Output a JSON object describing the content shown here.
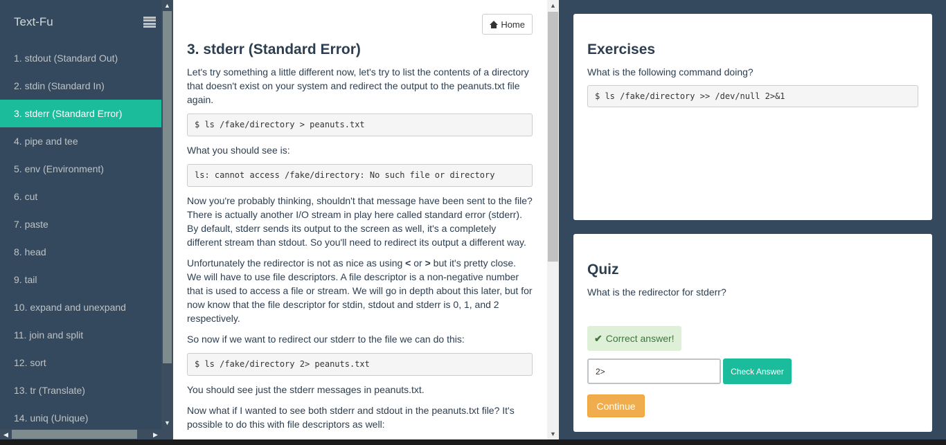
{
  "sidebar": {
    "brand": "Text-Fu",
    "items": [
      {
        "label": "1. stdout (Standard Out)"
      },
      {
        "label": "2. stdin (Standard In)"
      },
      {
        "label": "3. stderr (Standard Error)"
      },
      {
        "label": "4. pipe and tee"
      },
      {
        "label": "5. env (Environment)"
      },
      {
        "label": "6. cut"
      },
      {
        "label": "7. paste"
      },
      {
        "label": "8. head"
      },
      {
        "label": "9. tail"
      },
      {
        "label": "10. expand and unexpand"
      },
      {
        "label": "11. join and split"
      },
      {
        "label": "12. sort"
      },
      {
        "label": "13. tr (Translate)"
      },
      {
        "label": "14. uniq (Unique)"
      }
    ],
    "active_index": 2,
    "active_color": "#1abc9c"
  },
  "content": {
    "home_label": "Home",
    "title": "3. stderr (Standard Error)",
    "p1": "Let's try something a little different now, let's try to list the contents of a directory that doesn't exist on your system and redirect the output to the peanuts.txt file again.",
    "code1": "$ ls /fake/directory > peanuts.txt",
    "p2": "What you should see is:",
    "code2": "ls: cannot access /fake/directory: No such file or directory",
    "p3": "Now you're probably thinking, shouldn't that message have been sent to the file? There is actually another I/O stream in play here called standard error (stderr). By default, stderr sends its output to the screen as well, it's a completely different stream than stdout. So you'll need to redirect its output a different way.",
    "p4_a": "Unfortunately the redirector is not as nice as using ",
    "p4_op1": "<",
    "p4_or": " or ",
    "p4_op2": ">",
    "p4_b": " but it's pretty close. We will have to use file descriptors. A file descriptor is a non-negative number that is used to access a file or stream. We will go in depth about this later, but for now know that the file descriptor for stdin, stdout and stderr is 0, 1, and 2 respectively.",
    "p5": "So now if we want to redirect our stderr to the file we can do this:",
    "code3": "$ ls /fake/directory 2> peanuts.txt",
    "p6": "You should see just the stderr messages in peanuts.txt.",
    "p7": "Now what if I wanted to see both stderr and stdout in the peanuts.txt file? It's possible to do this with file descriptors as well:"
  },
  "exercises": {
    "title": "Exercises",
    "question": "What is the following command doing?",
    "code": "$ ls /fake/directory >> /dev/null 2>&1"
  },
  "quiz": {
    "title": "Quiz",
    "question": "What is the redirector for stderr?",
    "feedback": "Correct answer!",
    "answer_value": "2>",
    "check_label": "Check Answer",
    "continue_label": "Continue"
  },
  "icons": [
    "menu-icon",
    "home-icon",
    "check-icon"
  ]
}
